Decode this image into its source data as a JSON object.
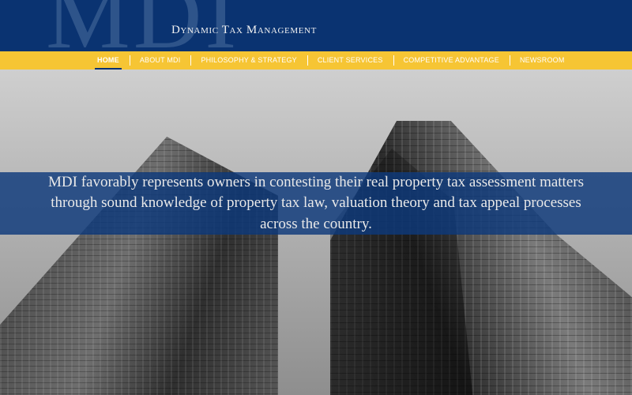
{
  "header": {
    "logo_text": "MDI",
    "tagline": "Dynamic Tax Management"
  },
  "nav": {
    "items": [
      {
        "label": "HOME",
        "active": true
      },
      {
        "label": "ABOUT MDI"
      },
      {
        "label": "PHILOSOPHY & STRATEGY"
      },
      {
        "label": "CLIENT SERVICES"
      },
      {
        "label": "COMPETITIVE ADVANTAGE"
      },
      {
        "label": "NEWSROOM"
      }
    ]
  },
  "hero": {
    "statement": "MDI favorably represents owners in contesting their real property tax assessment matters through sound knowledge of property tax law, valuation theory and tax appeal processes across the country."
  },
  "colors": {
    "header_bg": "#0a3371",
    "nav_bg": "#f6c534",
    "banner_bg": "#0d397b"
  }
}
